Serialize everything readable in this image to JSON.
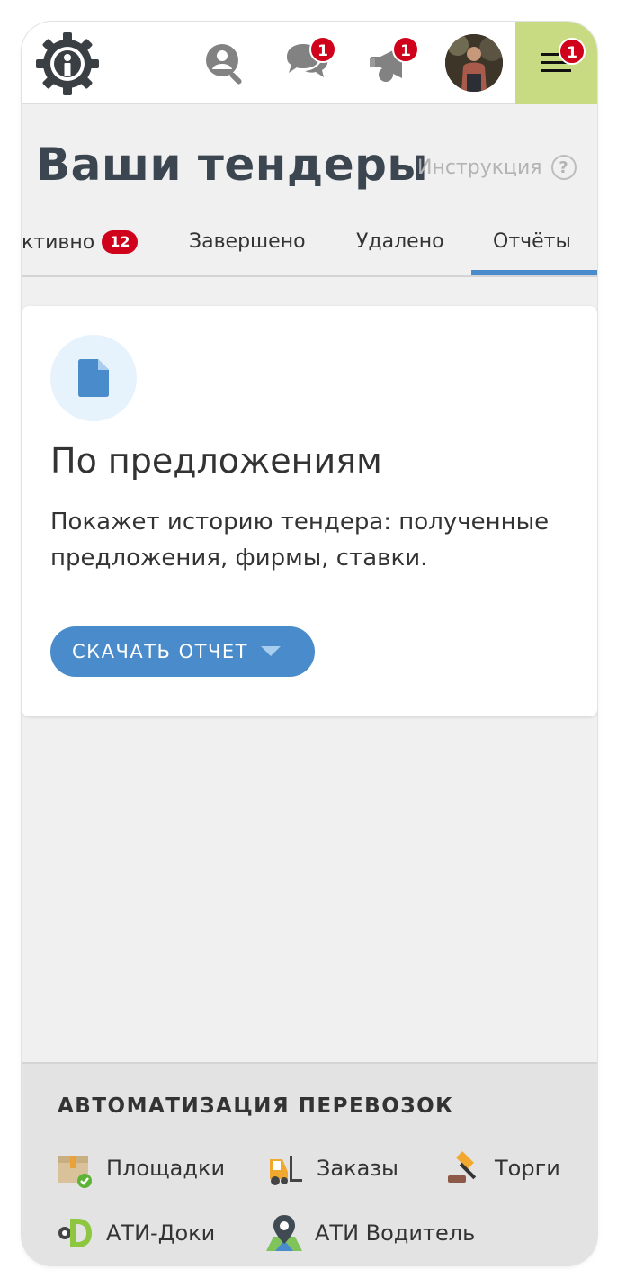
{
  "header": {
    "logo_icon": "gear-logo-icon",
    "search_icon": "search-icon",
    "messages": {
      "icon": "chat-icon",
      "badge": "1"
    },
    "announcements": {
      "icon": "megaphone-icon",
      "badge": "1"
    },
    "avatar_icon": "user-avatar",
    "menu": {
      "icon": "hamburger-icon",
      "badge": "1"
    }
  },
  "page": {
    "title": "Ваши тендеры",
    "help_label": "Инструкция",
    "help_icon": "?"
  },
  "tabs": [
    {
      "label": "ктивно",
      "badge": "12"
    },
    {
      "label": "Завершено"
    },
    {
      "label": "Удалено"
    },
    {
      "label": "Отчёты",
      "active": true
    }
  ],
  "report_card": {
    "icon": "document-icon",
    "title": "По предложениям",
    "description": "Покажет историю тендера: полученные предложения, фирмы, ставки.",
    "button_label": "СКАЧАТЬ ОТЧЕТ",
    "button_icon": "caret-down-icon"
  },
  "footer": {
    "title": "АВТОМАТИЗАЦИЯ ПЕРЕВОЗОК",
    "links": [
      {
        "label": "Площадки",
        "icon": "box-check-icon"
      },
      {
        "label": "Заказы",
        "icon": "forklift-icon"
      },
      {
        "label": "Торги",
        "icon": "gavel-icon"
      },
      {
        "label": "АТИ-Доки",
        "icon": "ati-docs-icon"
      },
      {
        "label": "АТИ Водитель",
        "icon": "map-pin-icon"
      }
    ]
  },
  "colors": {
    "accent_blue": "#4a8ccb",
    "badge_red": "#d0021b",
    "menu_green": "#c8db82",
    "header_icon_gray": "#828282"
  }
}
